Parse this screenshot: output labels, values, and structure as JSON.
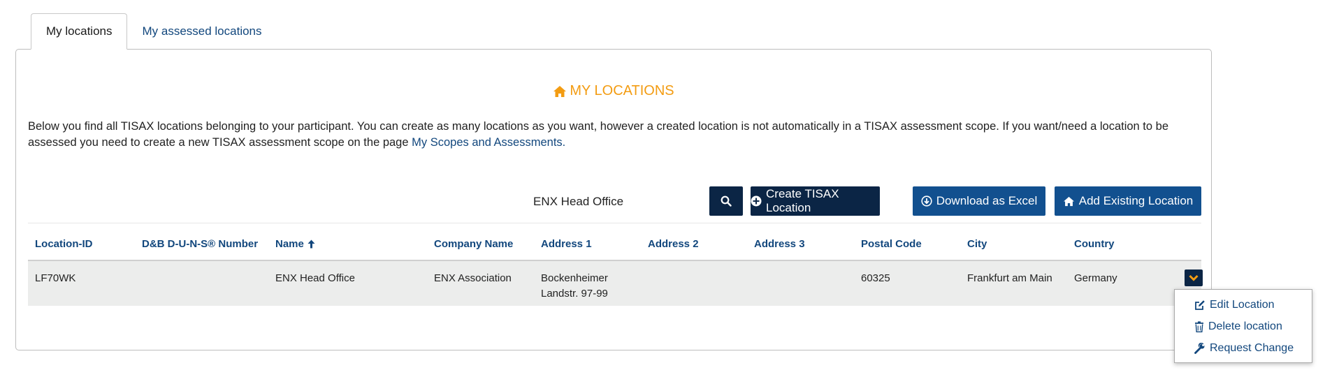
{
  "tabs": [
    {
      "label": "My locations",
      "active": true
    },
    {
      "label": "My assessed locations",
      "active": false
    }
  ],
  "panel": {
    "title": "MY LOCATIONS",
    "description_text": "Below you find all TISAX locations belonging to your participant. You can create as many locations as you want, however a created location is not automatically in a TISAX assessment scope. If you want/need a location to be assessed you need to create a new TISAX assessment scope on the page",
    "description_link": "My Scopes and Assessments."
  },
  "toolbar": {
    "search_value": "ENX Head Office",
    "create_label": "Create TISAX Location",
    "excel_label": "Download as Excel",
    "existing_label": "Add Existing Location"
  },
  "table": {
    "headers": [
      "Location-ID",
      "D&B D-U-N-S® Number",
      "Name",
      "Company Name",
      "Address 1",
      "Address 2",
      "Address 3",
      "Postal Code",
      "City",
      "Country"
    ],
    "sorted_column": "Name",
    "rows": [
      {
        "location_id": "LF70WK",
        "duns": "",
        "name": "ENX Head Office",
        "company": "ENX Association",
        "address1": "Bockenheimer Landstr. 97-99",
        "address2": "",
        "address3": "",
        "postal": "60325",
        "city": "Frankfurt am Main",
        "country": "Germany"
      }
    ]
  },
  "row_menu": {
    "edit_label": "Edit Location",
    "delete_label": "Delete location",
    "request_label": "Request Change"
  },
  "colors": {
    "accent_orange": "#f39c12",
    "link_blue": "#12477d",
    "button_dark": "#0b2545",
    "button_blue": "#12508f",
    "row_bg": "#ecedec"
  }
}
